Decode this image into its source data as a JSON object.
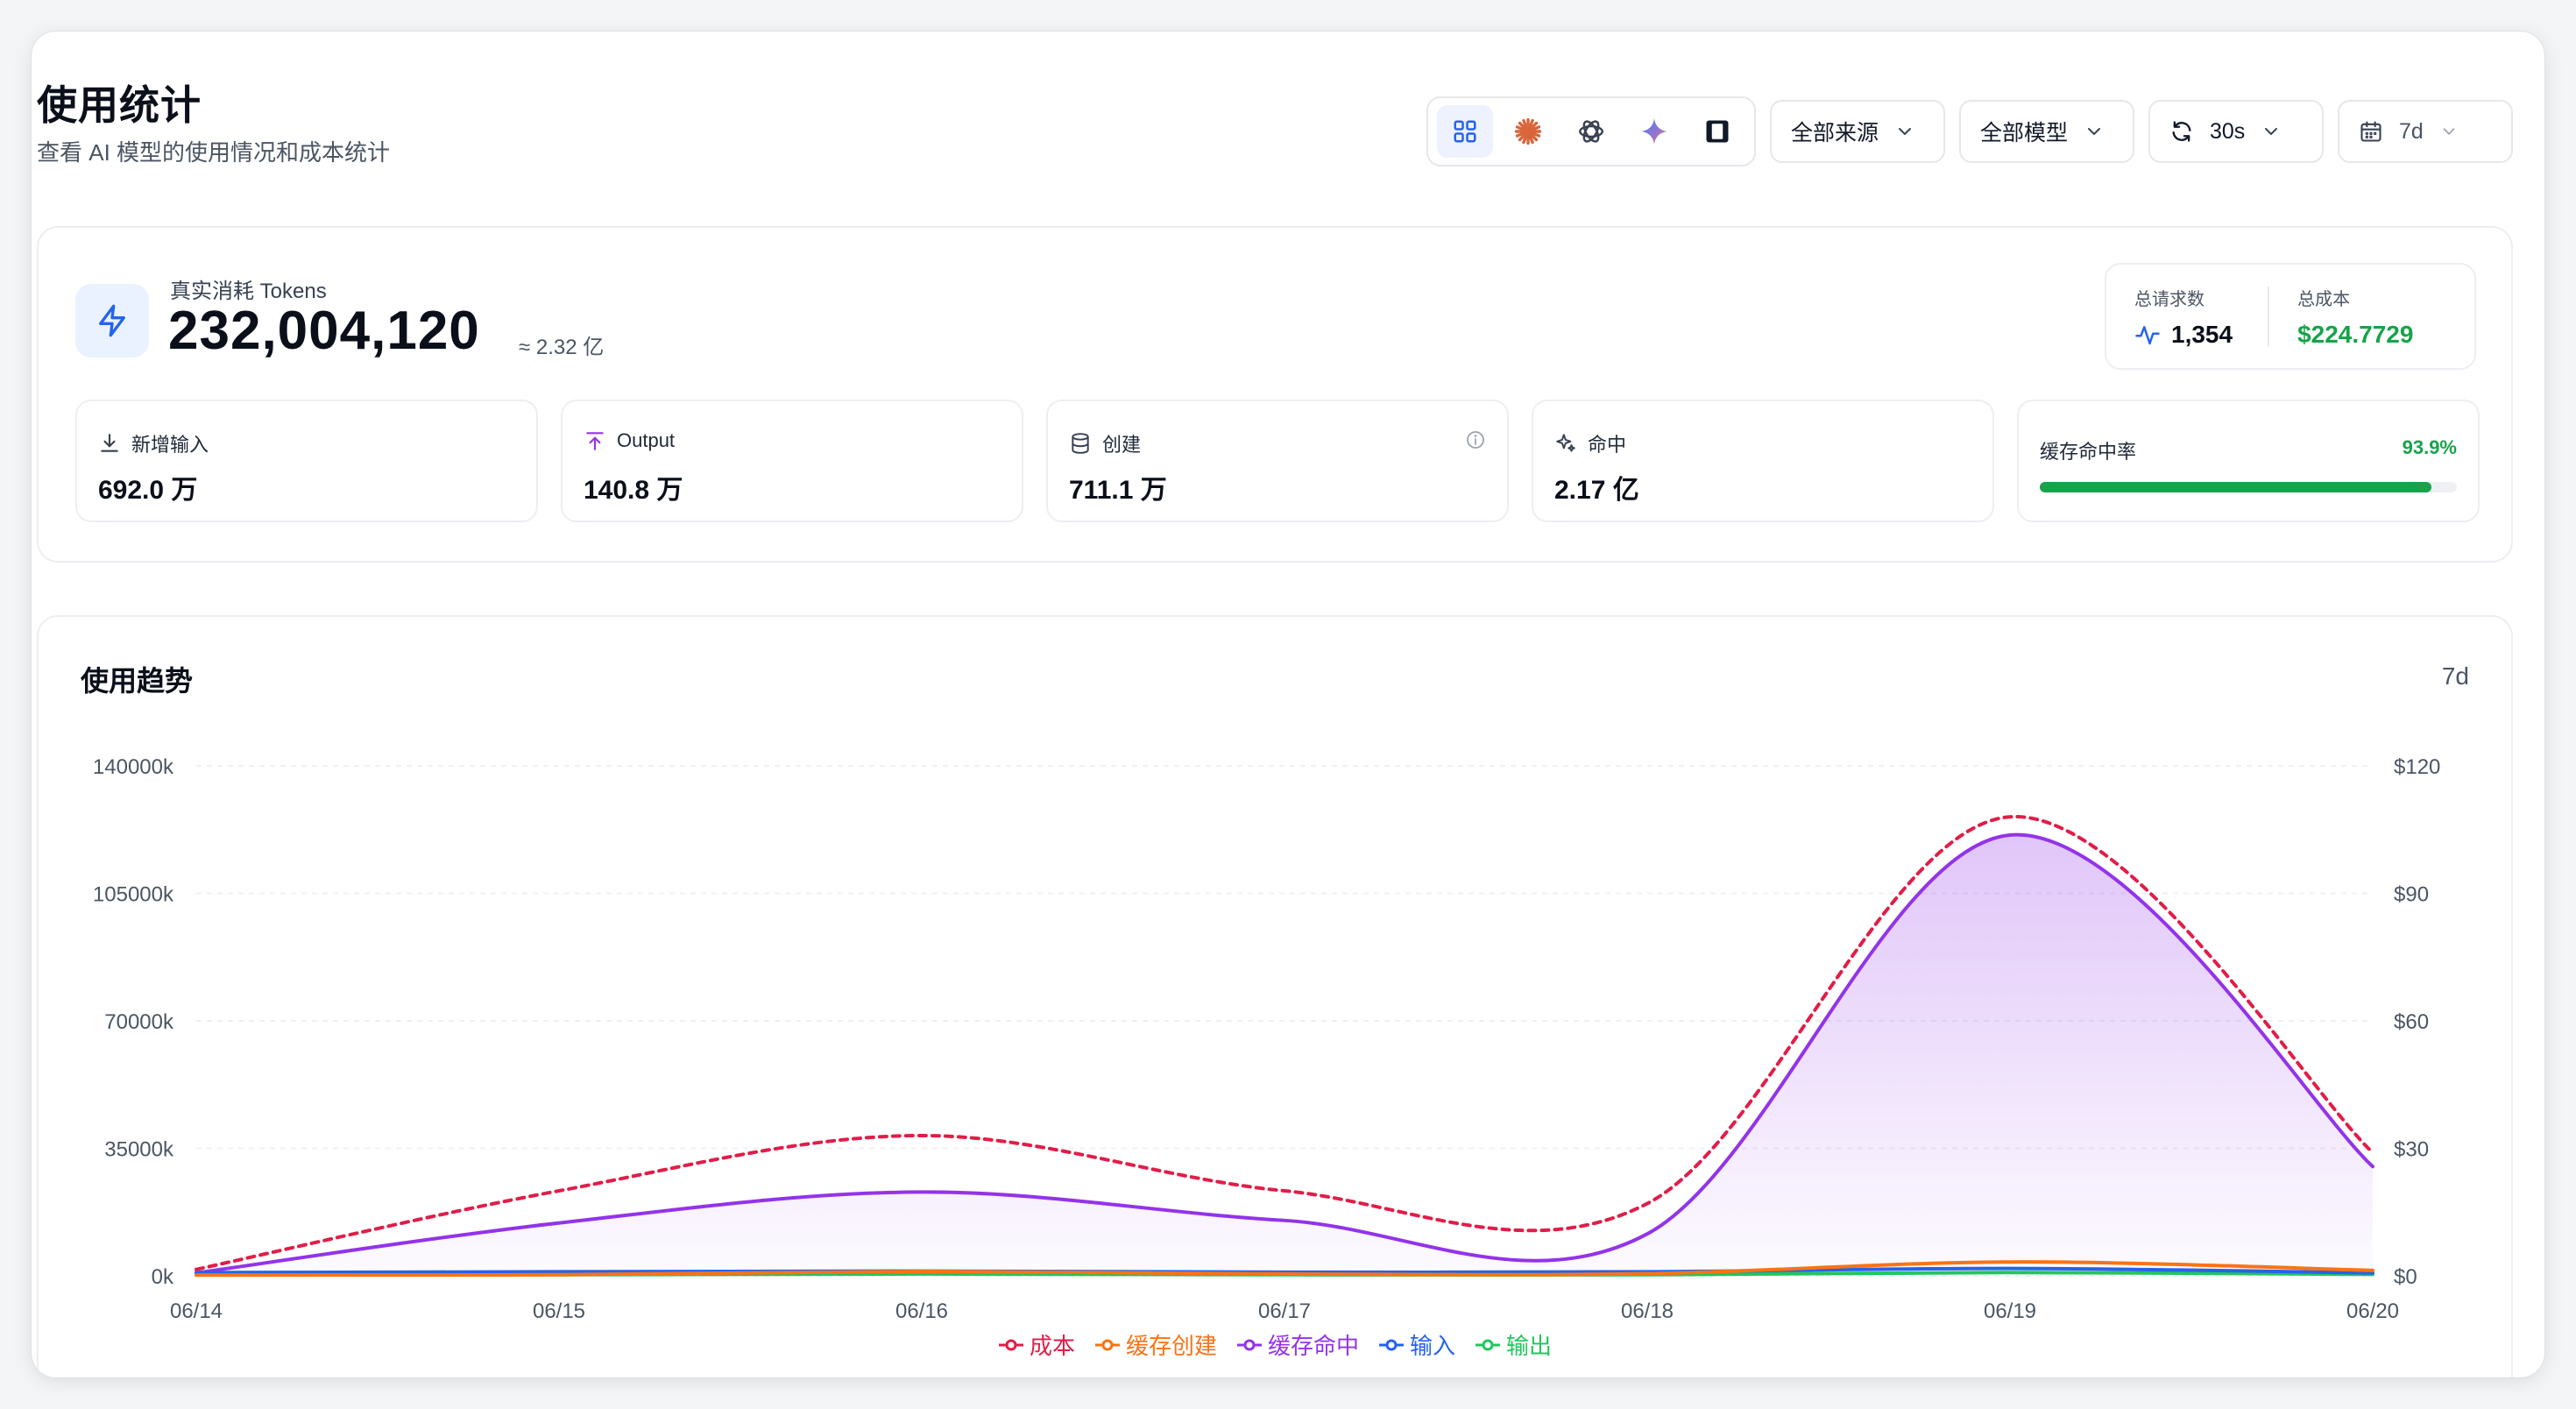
{
  "header": {
    "title": "使用统计",
    "subtitle": "查看 AI 模型的使用情况和成本统计"
  },
  "toolbar": {
    "providers": [
      {
        "icon": "grid-icon",
        "active": true
      },
      {
        "icon": "claude-icon",
        "active": false
      },
      {
        "icon": "openai-icon",
        "active": false
      },
      {
        "icon": "gemini-icon",
        "active": false
      },
      {
        "icon": "square-logo-icon",
        "active": false
      }
    ],
    "source_select": "全部来源",
    "model_select": "全部模型",
    "refresh_select": "30s",
    "range_select": "7d"
  },
  "tokens": {
    "label": "真实消耗 Tokens",
    "value": "232,004,120",
    "approx": "≈ 2.32 亿"
  },
  "summary": {
    "requests_label": "总请求数",
    "requests_value": "1,354",
    "cost_label": "总成本",
    "cost_value": "$224.7729"
  },
  "metrics": {
    "input": {
      "label": "新增输入",
      "value": "692.0 万"
    },
    "output": {
      "label": "Output",
      "value": "140.8 万"
    },
    "create": {
      "label": "创建",
      "value": "711.1 万"
    },
    "hit": {
      "label": "命中",
      "value": "2.17 亿"
    },
    "hit_rate": {
      "label": "缓存命中率",
      "value": "93.9%",
      "fraction": 0.939
    }
  },
  "chart_panel": {
    "title": "使用趋势",
    "range": "7d"
  },
  "colors": {
    "cost": "#e11d48",
    "cache_create": "#f97316",
    "cache_hit": "#9333ea",
    "input": "#2563eb",
    "output": "#22c55e",
    "accent": "#2563eb",
    "success": "#16a34a"
  },
  "chart_data": {
    "type": "area",
    "categories": [
      "06/14",
      "06/15",
      "06/16",
      "06/17",
      "06/18",
      "06/19",
      "06/20"
    ],
    "y_left": {
      "ticks": [
        "0k",
        "35000k",
        "70000k",
        "105000k",
        "140000k"
      ],
      "range": [
        0,
        140000
      ]
    },
    "y_right": {
      "ticks": [
        "$0",
        "$30",
        "$60",
        "$90",
        "$120"
      ],
      "range": [
        0,
        120
      ]
    },
    "series": [
      {
        "name": "成本",
        "axis": "right",
        "style": "dashed",
        "values": [
          1.5,
          20,
          33,
          20,
          17,
          108,
          29
        ]
      },
      {
        "name": "缓存创建",
        "axis": "left",
        "values": [
          200,
          300,
          1200,
          500,
          600,
          3800,
          1500
        ]
      },
      {
        "name": "缓存命中",
        "axis": "left",
        "fill": true,
        "values": [
          800,
          14500,
          23000,
          15200,
          11500,
          121000,
          30000
        ]
      },
      {
        "name": "输入",
        "axis": "left",
        "values": [
          900,
          1100,
          1300,
          1000,
          1100,
          2000,
          800
        ]
      },
      {
        "name": "输出",
        "axis": "left",
        "values": [
          200,
          300,
          500,
          300,
          300,
          900,
          400
        ]
      }
    ],
    "grid": true,
    "legend": "bottom"
  }
}
